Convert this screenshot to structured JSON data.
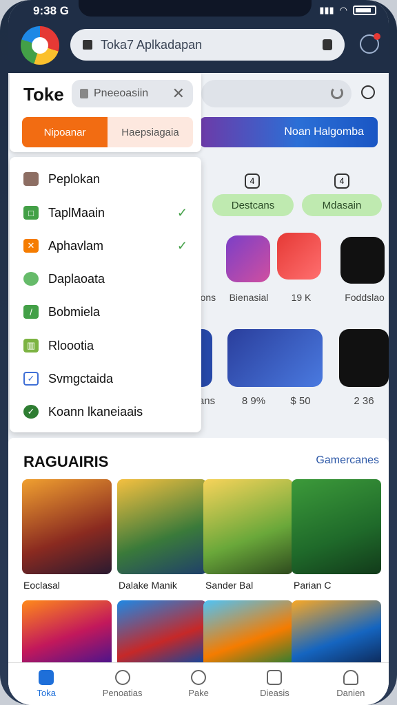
{
  "status": {
    "time": "9:38",
    "sim": "G"
  },
  "browser": {
    "url_text": "Toka7 Aplkadapan"
  },
  "top": {
    "banner_text": "Noan Halgomba"
  },
  "dropdown": {
    "title": "Toke",
    "search_value": "Pneeoasiin",
    "segments": [
      "Nipoanar",
      "Haepsiagaia"
    ]
  },
  "menu": {
    "items": [
      {
        "label": "Peplokan",
        "checked": false,
        "icon_color": "#8d6e63"
      },
      {
        "label": "TaplMaain",
        "checked": true,
        "icon_color": "#43a047"
      },
      {
        "label": "Aphavlam",
        "checked": true,
        "icon_color": "#f57c00"
      },
      {
        "label": "Daplaoata",
        "checked": false,
        "icon_color": "#66bb6a"
      },
      {
        "label": "Bobmiela",
        "checked": false,
        "icon_color": "#43a047"
      },
      {
        "label": "Rloootia",
        "checked": false,
        "icon_color": "#7cb342"
      },
      {
        "label": "Svmgctaida",
        "checked": false,
        "icon_color": "#3f6fd6"
      },
      {
        "label": "Koann lkaneiaais",
        "checked": false,
        "icon_color": "#2e7d32"
      }
    ]
  },
  "side": {
    "counters": [
      "4",
      "4"
    ],
    "pills": [
      "Destcans",
      "Mdasain"
    ],
    "apps_row1": [
      "oons",
      "Bienasial",
      "19 K",
      "Foddslao"
    ],
    "prices_row2": [
      "ans",
      "8 9%",
      "$ 50",
      "2 36"
    ]
  },
  "games": {
    "title": "RAGUAIRIS",
    "link": "Gamercanes",
    "items": [
      {
        "name": "Eoclasal",
        "art": "BAUNAN"
      },
      {
        "name": "Dalake Manik",
        "art": "DIARRON"
      },
      {
        "name": "Sander Bal",
        "art": "SHERNA"
      },
      {
        "name": "Parian C",
        "art": "MICHKAS"
      }
    ],
    "row2_art": [
      "FAVIAS",
      "",
      "",
      "TIVIEROS"
    ]
  },
  "tabs": [
    {
      "label": "Toka",
      "icon": "home-icon"
    },
    {
      "label": "Penoatias",
      "icon": "clock-icon"
    },
    {
      "label": "Pake",
      "icon": "compass-icon"
    },
    {
      "label": "Dieasis",
      "icon": "tablet-icon"
    },
    {
      "label": "Danien",
      "icon": "person-icon"
    }
  ],
  "colors": {
    "accent": "#1e6fd9",
    "segment_active": "#f26c12",
    "pill": "#bfeab0",
    "header": "#1f2e46"
  }
}
